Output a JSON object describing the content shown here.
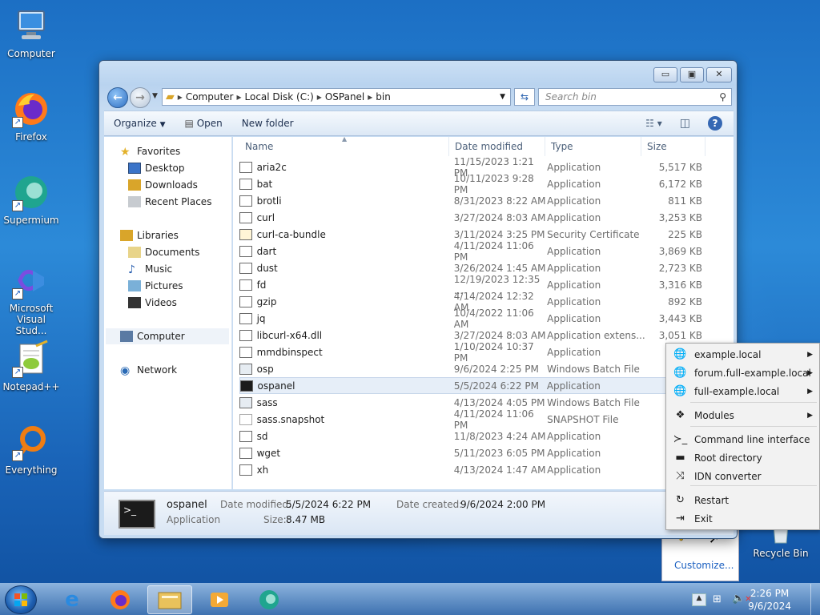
{
  "desktop": {
    "icons": [
      {
        "label": "Computer"
      },
      {
        "label": "Firefox"
      },
      {
        "label": "Supermium"
      },
      {
        "label": "Microsoft Visual Stud..."
      },
      {
        "label": "Notepad++"
      },
      {
        "label": "Everything"
      },
      {
        "label": "Recycle Bin"
      }
    ]
  },
  "window": {
    "breadcrumb": [
      "Computer",
      "Local Disk (C:)",
      "OSPanel",
      "bin"
    ],
    "search_placeholder": "Search bin",
    "toolbar": {
      "organize": "Organize",
      "open": "Open",
      "new_folder": "New folder"
    },
    "nav": {
      "favorites": "Favorites",
      "desktop": "Desktop",
      "downloads": "Downloads",
      "recent": "Recent Places",
      "libraries": "Libraries",
      "documents": "Documents",
      "music": "Music",
      "pictures": "Pictures",
      "videos": "Videos",
      "computer": "Computer",
      "network": "Network"
    },
    "columns": {
      "name": "Name",
      "date": "Date modified",
      "type": "Type",
      "size": "Size"
    },
    "files": [
      {
        "name": "aria2c",
        "date": "11/15/2023 1:21 PM",
        "type": "Application",
        "size": "5,517 KB",
        "icon": "app"
      },
      {
        "name": "bat",
        "date": "10/11/2023 9:28 PM",
        "type": "Application",
        "size": "6,172 KB",
        "icon": "app"
      },
      {
        "name": "brotli",
        "date": "8/31/2023 8:22 AM",
        "type": "Application",
        "size": "811 KB",
        "icon": "app"
      },
      {
        "name": "curl",
        "date": "3/27/2024 8:03 AM",
        "type": "Application",
        "size": "3,253 KB",
        "icon": "app"
      },
      {
        "name": "curl-ca-bundle",
        "date": "3/11/2024 3:25 PM",
        "type": "Security Certificate",
        "size": "225 KB",
        "icon": "cert"
      },
      {
        "name": "dart",
        "date": "4/11/2024 11:06 PM",
        "type": "Application",
        "size": "3,869 KB",
        "icon": "app"
      },
      {
        "name": "dust",
        "date": "3/26/2024 1:45 AM",
        "type": "Application",
        "size": "2,723 KB",
        "icon": "app"
      },
      {
        "name": "fd",
        "date": "12/19/2023 12:35 ...",
        "type": "Application",
        "size": "3,316 KB",
        "icon": "app"
      },
      {
        "name": "gzip",
        "date": "4/14/2024 12:32 AM",
        "type": "Application",
        "size": "892 KB",
        "icon": "app"
      },
      {
        "name": "jq",
        "date": "10/4/2022 11:06 AM",
        "type": "Application",
        "size": "3,443 KB",
        "icon": "app"
      },
      {
        "name": "libcurl-x64.dll",
        "date": "3/27/2024 8:03 AM",
        "type": "Application extens...",
        "size": "3,051 KB",
        "icon": "dll"
      },
      {
        "name": "mmdbinspect",
        "date": "1/10/2024 10:37 PM",
        "type": "Application",
        "size": "",
        "icon": "app"
      },
      {
        "name": "osp",
        "date": "9/6/2024 2:25 PM",
        "type": "Windows Batch File",
        "size": "",
        "icon": "bat"
      },
      {
        "name": "ospanel",
        "date": "5/5/2024 6:22 PM",
        "type": "Application",
        "size": "",
        "icon": "term"
      },
      {
        "name": "sass",
        "date": "4/13/2024 4:05 PM",
        "type": "Windows Batch File",
        "size": "",
        "icon": "bat"
      },
      {
        "name": "sass.snapshot",
        "date": "4/11/2024 11:06 PM",
        "type": "SNAPSHOT File",
        "size": "",
        "icon": "blank"
      },
      {
        "name": "sd",
        "date": "11/8/2023 4:24 AM",
        "type": "Application",
        "size": "",
        "icon": "app"
      },
      {
        "name": "wget",
        "date": "5/11/2023 6:05 PM",
        "type": "Application",
        "size": "",
        "icon": "app"
      },
      {
        "name": "xh",
        "date": "4/13/2024 1:47 AM",
        "type": "Application",
        "size": "",
        "icon": "app"
      }
    ],
    "details": {
      "name": "ospanel",
      "kind": "Application",
      "mod_label": "Date modified:",
      "mod_value": "5/5/2024 6:22 PM",
      "size_label": "Size:",
      "size_value": "8.47 MB",
      "created_label": "Date created:",
      "created_value": "9/6/2024 2:00 PM"
    }
  },
  "context_menu": {
    "items": [
      {
        "label": "example.local",
        "icon": "globe-icon",
        "submenu": true
      },
      {
        "label": "forum.full-example.local",
        "icon": "globe-icon",
        "submenu": true
      },
      {
        "label": "full-example.local",
        "icon": "globe-icon",
        "submenu": true
      },
      {
        "label": "Modules",
        "icon": "modules-icon",
        "submenu": true
      },
      {
        "label": "Command line interface",
        "icon": "terminal-icon",
        "submenu": false
      },
      {
        "label": "Root directory",
        "icon": "folder-icon",
        "submenu": false
      },
      {
        "label": "IDN converter",
        "icon": "shuffle-icon",
        "submenu": false
      },
      {
        "label": "Restart",
        "icon": "restart-icon",
        "submenu": false
      },
      {
        "label": "Exit",
        "icon": "exit-icon",
        "submenu": false
      }
    ]
  },
  "tray_popup": {
    "customize": "Customize..."
  },
  "taskbar": {
    "time": "2:26 PM",
    "date": "9/6/2024"
  }
}
